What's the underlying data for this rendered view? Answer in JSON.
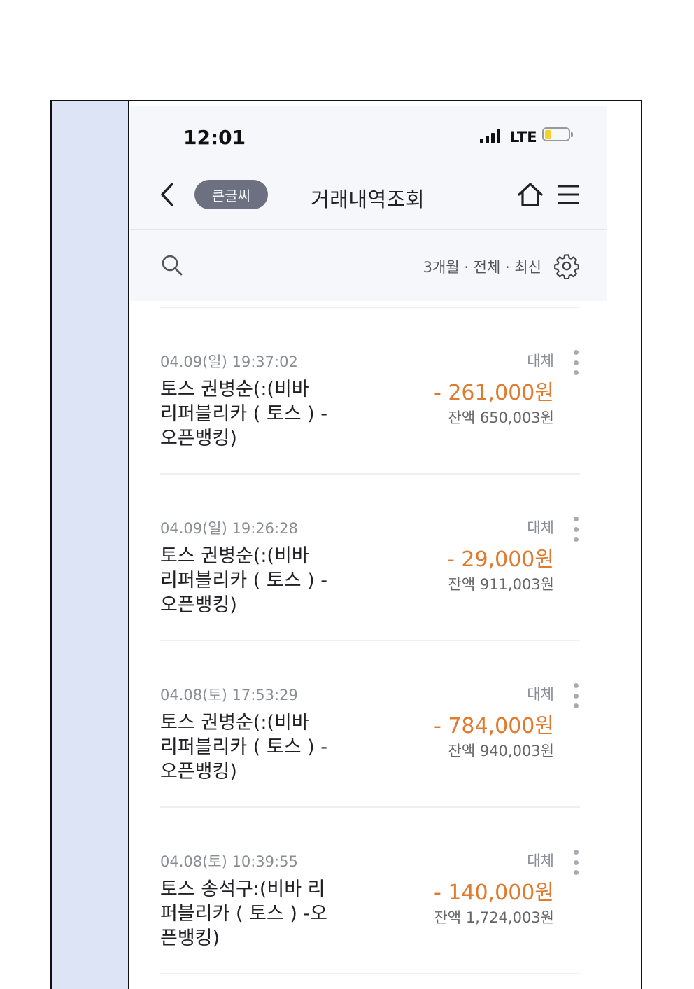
{
  "status": {
    "time": "12:01",
    "network": "LTE"
  },
  "nav": {
    "badge": "큰글씨",
    "title": "거래내역조회"
  },
  "filter": {
    "summary": "3개월 · 전체 · 최신"
  },
  "transactions": [
    {
      "datetime": "04.09(일) 19:37:02",
      "description": "토스 권병순(:(비바 리퍼블리카 ( 토스 ) -오픈뱅킹)",
      "type": "대체",
      "amount": "- 261,000원",
      "balance": "잔액  650,003원"
    },
    {
      "datetime": "04.09(일) 19:26:28",
      "description": "토스 권병순(:(비바 리퍼블리카 ( 토스 ) -오픈뱅킹)",
      "type": "대체",
      "amount": "- 29,000원",
      "balance": "잔액  911,003원"
    },
    {
      "datetime": "04.08(토) 17:53:29",
      "description": "토스 권병순(:(비바 리퍼블리카 ( 토스 ) -오픈뱅킹)",
      "type": "대체",
      "amount": "- 784,000원",
      "balance": "잔액  940,003원"
    },
    {
      "datetime": "04.08(토) 10:39:55",
      "description": "토스 송석구:(비바 리퍼블리카 ( 토스 ) -오픈뱅킹)",
      "type": "대체",
      "amount": "- 140,000원",
      "balance": "잔액  1,724,003원"
    }
  ],
  "colors": {
    "accent": "#e07a2e",
    "side_panel": "#dde4f6",
    "badge_bg": "#6c7080"
  }
}
